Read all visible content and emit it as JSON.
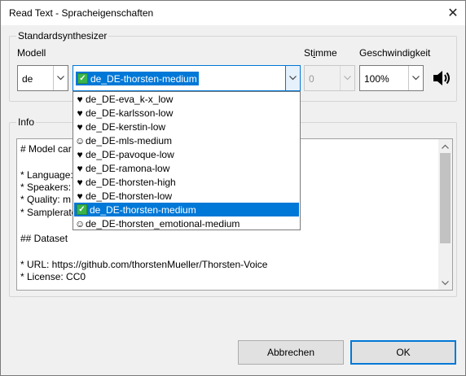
{
  "window": {
    "title": "Read Text - Spracheigenschaften",
    "close_glyph": "✕"
  },
  "synth_group": {
    "legend": "Standardsynthesizer",
    "model_label": "Modell",
    "voice_label": "Stimme",
    "speed_label": "Geschwindigkeit",
    "language_value": "de",
    "model_value": "de_DE-thorsten-medium",
    "voice_value": "0",
    "speed_value": "100%"
  },
  "dropdown": {
    "items": [
      {
        "icon": "♥",
        "label": "de_DE-eva_k-x_low"
      },
      {
        "icon": "♥",
        "label": "de_DE-karlsson-low"
      },
      {
        "icon": "♥",
        "label": "de_DE-kerstin-low"
      },
      {
        "icon": "☺",
        "label": "de_DE-mls-medium"
      },
      {
        "icon": "♥",
        "label": "de_DE-pavoque-low"
      },
      {
        "icon": "♥",
        "label": "de_DE-ramona-low"
      },
      {
        "icon": "♥",
        "label": "de_DE-thorsten-high"
      },
      {
        "icon": "♥",
        "label": "de_DE-thorsten-low"
      },
      {
        "icon": "✓",
        "label": "de_DE-thorsten-medium"
      },
      {
        "icon": "☺",
        "label": "de_DE-thorsten_emotional-medium"
      }
    ]
  },
  "info_group": {
    "legend": "Info",
    "lines": [
      "# Model car",
      "",
      "* Language:",
      "* Speakers: 1",
      "* Quality: m",
      "* Samplerate",
      "",
      "## Dataset",
      "",
      "* URL: https://github.com/thorstenMueller/Thorsten-Voice",
      "* License: CC0"
    ]
  },
  "buttons": {
    "cancel": "Abbrechen",
    "ok": "OK"
  },
  "icons": {
    "speaker": "speaker-icon",
    "dropdown_arrow": "chevron-down-icon"
  },
  "colors": {
    "selection": "#0078d7",
    "check_green": "#39b54a"
  }
}
